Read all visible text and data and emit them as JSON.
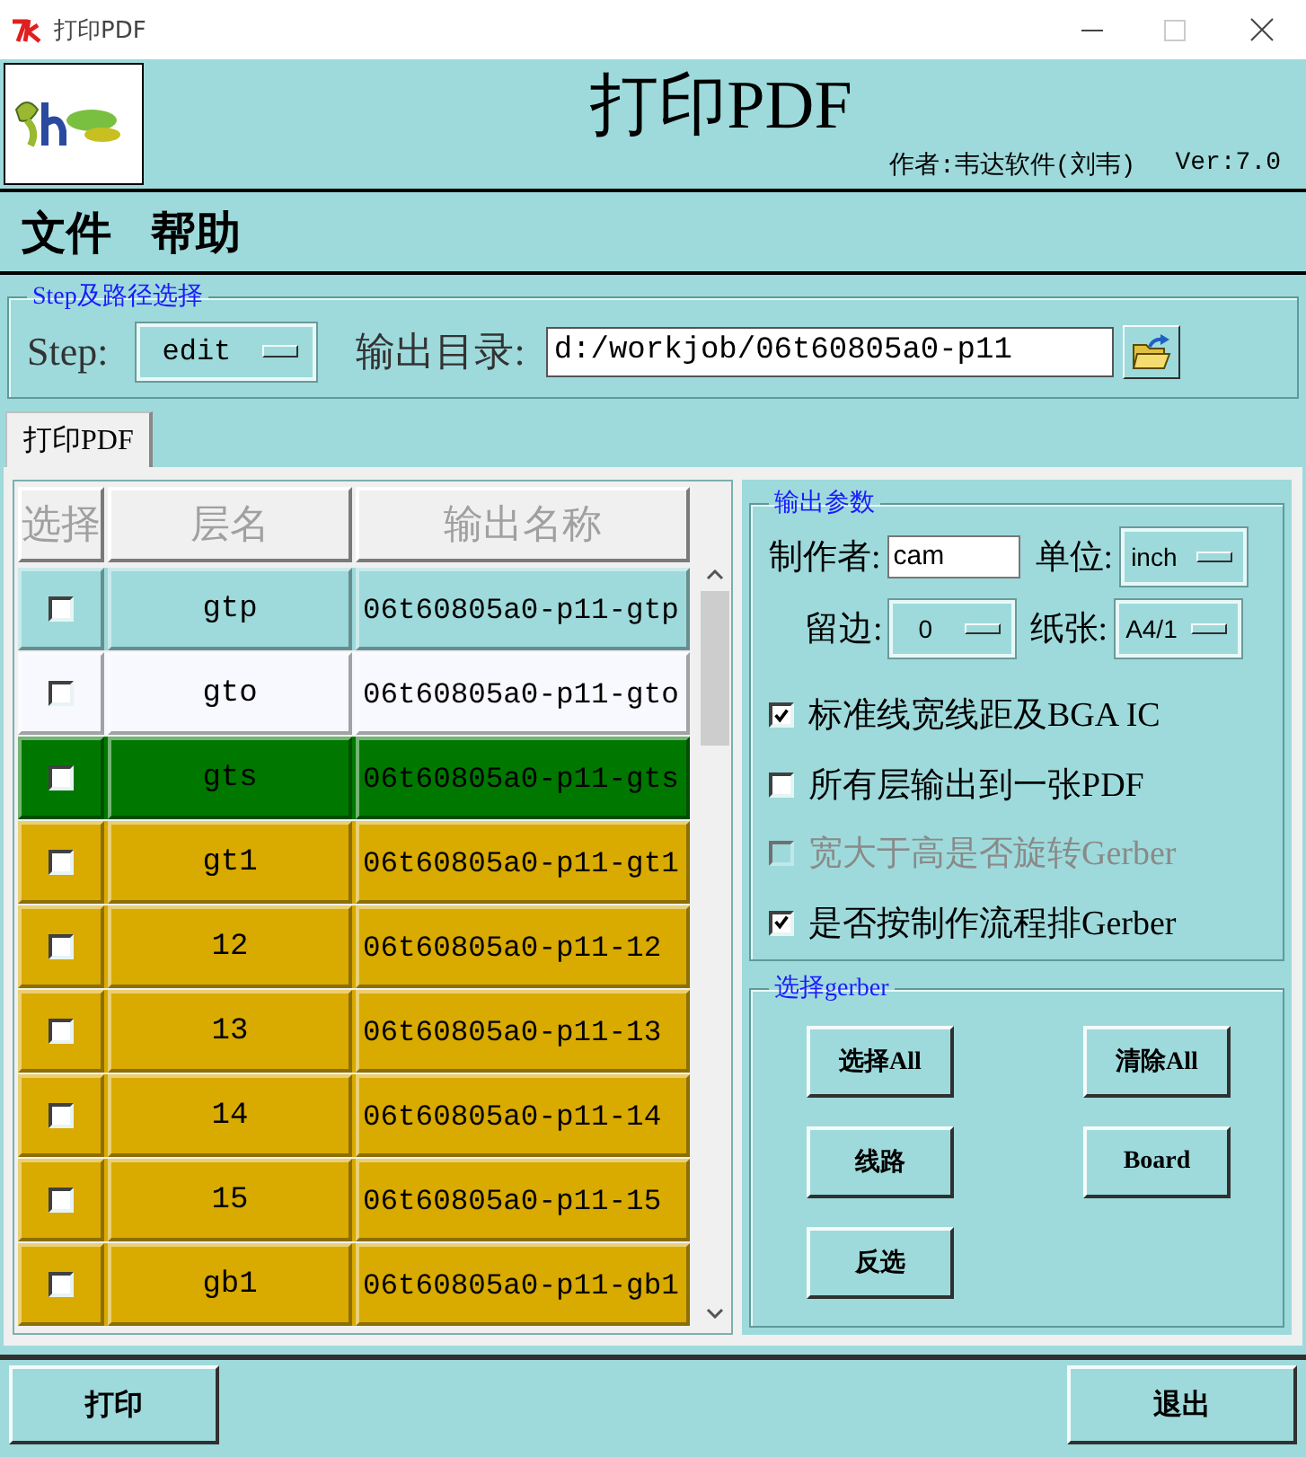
{
  "window": {
    "title": "打印PDF"
  },
  "header": {
    "title": "打印PDF",
    "author": "作者:韦达软件(刘韦)",
    "version": "Ver:7.0"
  },
  "menu": [
    "文件",
    "帮助"
  ],
  "step_group": {
    "legend": "Step及路径选择",
    "step_label": "Step:",
    "step_value": "edit",
    "output_dir_label": "输出目录:",
    "output_dir_value": "d:/workjob/06t60805a0-p11"
  },
  "tabs": [
    {
      "label": "打印PDF",
      "selected": true
    }
  ],
  "layer_table": {
    "columns": [
      "选择",
      "层名",
      "输出名称"
    ],
    "rows": [
      {
        "checked": false,
        "layer": "gtp",
        "output": "06t60805a0-p11-gtp",
        "color": "#9edadb"
      },
      {
        "checked": false,
        "layer": "gto",
        "output": "06t60805a0-p11-gto",
        "color": "#f8f8ff"
      },
      {
        "checked": false,
        "layer": "gts",
        "output": "06t60805a0-p11-gts",
        "color": "#007800"
      },
      {
        "checked": false,
        "layer": "gt1",
        "output": "06t60805a0-p11-gt1",
        "color": "#d9aa00"
      },
      {
        "checked": false,
        "layer": "12",
        "output": "06t60805a0-p11-12",
        "color": "#d9aa00"
      },
      {
        "checked": false,
        "layer": "13",
        "output": "06t60805a0-p11-13",
        "color": "#d9aa00"
      },
      {
        "checked": false,
        "layer": "14",
        "output": "06t60805a0-p11-14",
        "color": "#d9aa00"
      },
      {
        "checked": false,
        "layer": "15",
        "output": "06t60805a0-p11-15",
        "color": "#d9aa00"
      },
      {
        "checked": false,
        "layer": "gb1",
        "output": "06t60805a0-p11-gb1",
        "color": "#d9aa00"
      }
    ]
  },
  "output_params": {
    "legend": "输出参数",
    "fields": [
      {
        "label": "制作者:",
        "value": "cam",
        "kind": "text"
      },
      {
        "label": "单位:",
        "value": "inch",
        "kind": "select"
      },
      {
        "label": "留边:",
        "value": "0",
        "kind": "select"
      },
      {
        "label": "纸张:",
        "value": "A4/1",
        "kind": "select"
      }
    ],
    "options": [
      {
        "label": "标准线宽线距及BGA IC",
        "checked": true,
        "disabled": false
      },
      {
        "label": "所有层输出到一张PDF",
        "checked": false,
        "disabled": false
      },
      {
        "label": "宽大于高是否旋转Gerber",
        "checked": false,
        "disabled": true
      },
      {
        "label": "是否按制作流程排Gerber",
        "checked": true,
        "disabled": false
      }
    ]
  },
  "gerber_group": {
    "legend": "选择gerber",
    "buttons": [
      "选择All",
      "清除All",
      "线路",
      "Board",
      "反选"
    ]
  },
  "footer": {
    "buttons": [
      "打印",
      "退出"
    ]
  }
}
